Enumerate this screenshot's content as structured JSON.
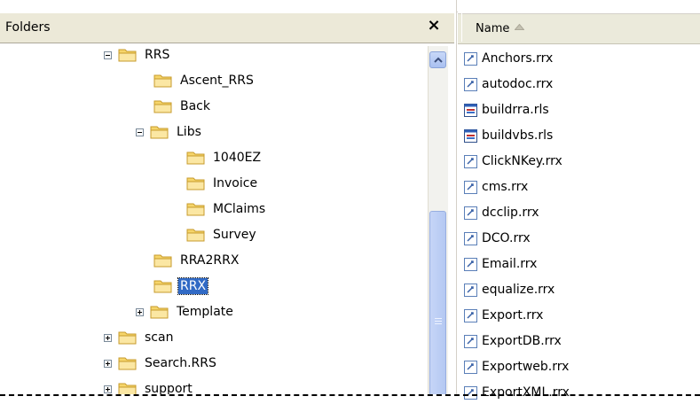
{
  "folders_pane": {
    "title": "Folders",
    "close_glyph": "×"
  },
  "tree": [
    {
      "label": "RRS",
      "depth": 0,
      "expander": "minus",
      "selected": false
    },
    {
      "label": "Ascent_RRS",
      "depth": 1,
      "expander": "none",
      "selected": false
    },
    {
      "label": "Back",
      "depth": 1,
      "expander": "none",
      "selected": false
    },
    {
      "label": "Libs",
      "depth": 1,
      "expander": "minus",
      "selected": false
    },
    {
      "label": "1040EZ",
      "depth": 2,
      "expander": "none",
      "selected": false
    },
    {
      "label": "Invoice",
      "depth": 2,
      "expander": "none",
      "selected": false
    },
    {
      "label": "MClaims",
      "depth": 2,
      "expander": "none",
      "selected": false
    },
    {
      "label": "Survey",
      "depth": 2,
      "expander": "none",
      "selected": false
    },
    {
      "label": "RRA2RRX",
      "depth": 1,
      "expander": "none",
      "selected": false
    },
    {
      "label": "RRX",
      "depth": 1,
      "expander": "none",
      "selected": true
    },
    {
      "label": "Template",
      "depth": 1,
      "expander": "plus",
      "selected": false
    },
    {
      "label": "scan",
      "depth": -1,
      "expander": "plus",
      "selected": false
    },
    {
      "label": "Search.RRS",
      "depth": -1,
      "expander": "plus",
      "selected": false
    },
    {
      "label": "support",
      "depth": -1,
      "expander": "plus",
      "selected": false
    }
  ],
  "file_list": {
    "column_name": "Name",
    "sort": "ascending",
    "files": [
      {
        "name": "Anchors.rrx",
        "icon": "rrx-file-icon"
      },
      {
        "name": "autodoc.rrx",
        "icon": "rrx-file-icon"
      },
      {
        "name": "buildrra.rls",
        "icon": "rls-file-icon"
      },
      {
        "name": "buildvbs.rls",
        "icon": "rls-file-icon"
      },
      {
        "name": "ClickNKey.rrx",
        "icon": "rrx-file-icon"
      },
      {
        "name": "cms.rrx",
        "icon": "rrx-file-icon"
      },
      {
        "name": "dcclip.rrx",
        "icon": "rrx-file-icon"
      },
      {
        "name": "DCO.rrx",
        "icon": "rrx-file-icon"
      },
      {
        "name": "Email.rrx",
        "icon": "rrx-file-icon"
      },
      {
        "name": "equalize.rrx",
        "icon": "rrx-file-icon"
      },
      {
        "name": "Export.rrx",
        "icon": "rrx-file-icon"
      },
      {
        "name": "ExportDB.rrx",
        "icon": "rrx-file-icon"
      },
      {
        "name": "Exportweb.rrx",
        "icon": "rrx-file-icon"
      },
      {
        "name": "ExportXML.rrx",
        "icon": "rrx-file-icon"
      }
    ]
  },
  "colors": {
    "selection": "#316ac5",
    "header_bg": "#ece9d8",
    "folder_yellow": "#f6d56a"
  }
}
